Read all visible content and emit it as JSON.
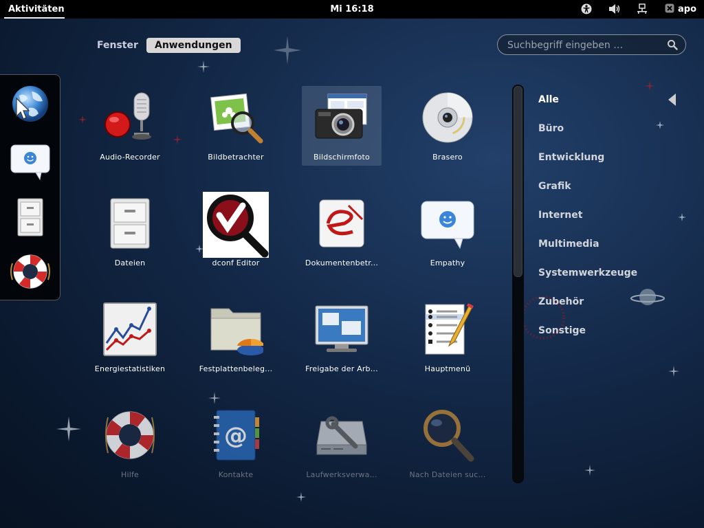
{
  "topbar": {
    "activities": "Aktivitäten",
    "clock": "Mi 16:18",
    "user": "apo",
    "tray_icons": [
      "accessibility-icon",
      "volume-icon",
      "network-icon",
      "user-status-icon"
    ]
  },
  "view_selector": {
    "windows": "Fenster",
    "applications": "Anwendungen"
  },
  "search": {
    "placeholder": "Suchbegriff eingeben …",
    "value": ""
  },
  "dash": {
    "items": [
      "web-browser-icon",
      "empathy-icon",
      "files-icon",
      "help-icon"
    ]
  },
  "apps": [
    {
      "label": "Audio-Recorder",
      "icon": "audio-recorder-icon"
    },
    {
      "label": "Bildbetrachter",
      "icon": "image-viewer-icon"
    },
    {
      "label": "Bildschirmfoto",
      "icon": "screenshot-icon"
    },
    {
      "label": "Brasero",
      "icon": "brasero-icon"
    },
    {
      "label": "Dateien",
      "icon": "files-icon"
    },
    {
      "label": "dconf Editor",
      "icon": "dconf-editor-icon"
    },
    {
      "label": "Dokumentenbetr...",
      "icon": "document-viewer-icon"
    },
    {
      "label": "Empathy",
      "icon": "empathy-icon"
    },
    {
      "label": "Energiestatistiken",
      "icon": "power-statistics-icon"
    },
    {
      "label": "Festplattenbeleg...",
      "icon": "disk-usage-icon"
    },
    {
      "label": "Freigabe der Arb...",
      "icon": "desktop-sharing-icon"
    },
    {
      "label": "Hauptmenü",
      "icon": "main-menu-icon"
    },
    {
      "label": "Hilfe",
      "icon": "help-icon"
    },
    {
      "label": "Kontakte",
      "icon": "contacts-icon"
    },
    {
      "label": "Laufwerksverwa...",
      "icon": "disk-utility-icon"
    },
    {
      "label": "Nach Dateien suc...",
      "icon": "search-files-icon"
    }
  ],
  "categories": [
    "Alle",
    "Büro",
    "Entwicklung",
    "Grafik",
    "Internet",
    "Multimedia",
    "Systemwerkzeuge",
    "Zubehör",
    "Sonstige"
  ],
  "active_category": "Alle",
  "colors": {
    "topbar": "#000000",
    "background": "#142a4a",
    "selected_tab": "#d8d8d8"
  }
}
